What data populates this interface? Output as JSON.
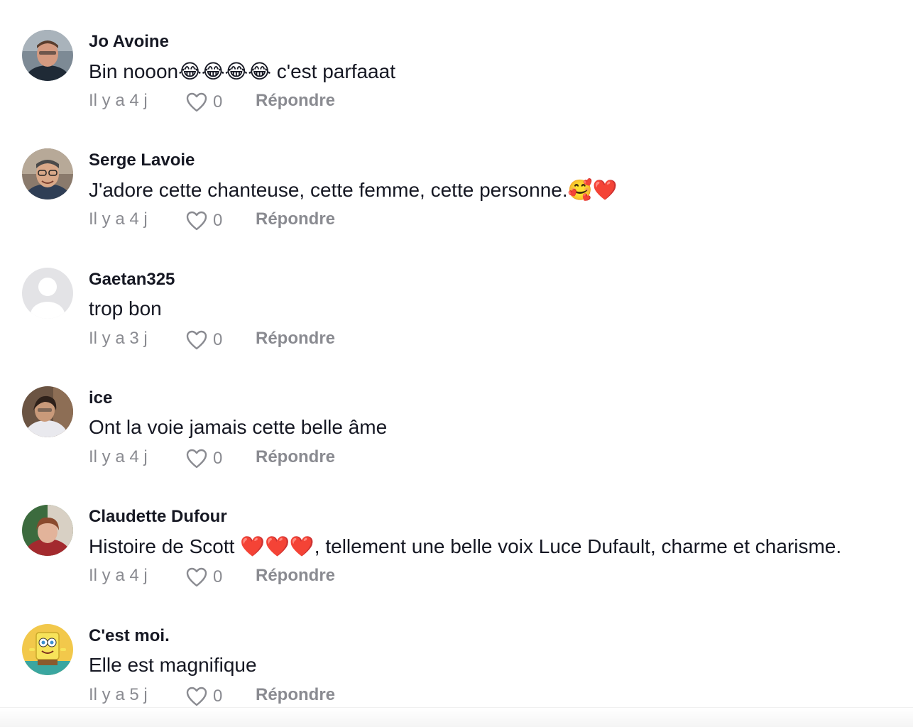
{
  "comments": [
    {
      "username": "Jo Avoine",
      "text": "Bin nooon😂😂😂😂 c'est parfaaat",
      "time": "Il y a 4 j",
      "likes": "0",
      "reply_label": "Répondre",
      "avatar": "photo-man-glasses-car"
    },
    {
      "username": "Serge Lavoie",
      "text": "J'adore cette chanteuse, cette femme, cette personne.🥰❤️",
      "time": "Il y a 4 j",
      "likes": "0",
      "reply_label": "Répondre",
      "avatar": "photo-man-glasses-smiling"
    },
    {
      "username": "Gaetan325",
      "text": "trop bon",
      "time": "Il y a 3 j",
      "likes": "0",
      "reply_label": "Répondre",
      "avatar": "default-user-placeholder"
    },
    {
      "username": "ice",
      "text": "Ont la voie jamais cette belle âme",
      "time": "Il y a 4 j",
      "likes": "0",
      "reply_label": "Répondre",
      "avatar": "photo-woman-white-shirt"
    },
    {
      "username": "Claudette Dufour",
      "text": "Histoire de Scott ❤️❤️❤️, tellement une belle voix Luce Dufault, charme et charisme.",
      "time": "Il y a 4 j",
      "likes": "0",
      "reply_label": "Répondre",
      "avatar": "photo-woman-red-sweater"
    },
    {
      "username": "C'est moi.",
      "text": "Elle est magnifique",
      "time": "Il y a 5 j",
      "likes": "0",
      "reply_label": "Répondre",
      "avatar": "spongebob-cartoon"
    }
  ],
  "colors": {
    "text_primary": "#161823",
    "text_secondary": "#8a8b91",
    "background": "#ffffff"
  }
}
